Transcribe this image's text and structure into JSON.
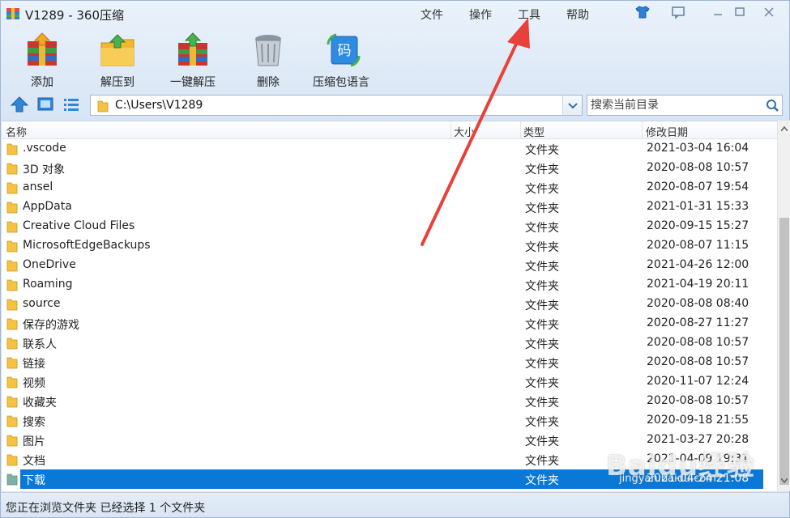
{
  "window": {
    "title": "V1289 - 360压缩",
    "menu": [
      "文件",
      "操作",
      "工具",
      "帮助"
    ]
  },
  "toolbar": {
    "add_label": "添加",
    "extract_to_label": "解压到",
    "one_click_extract_label": "一键解压",
    "delete_label": "删除",
    "language_label": "压缩包语言",
    "language_glyph": "码"
  },
  "address": {
    "path": "C:\\Users\\V1289"
  },
  "search": {
    "placeholder": "搜索当前目录"
  },
  "columns": {
    "name": "名称",
    "size": "大小",
    "type": "类型",
    "modified": "修改日期"
  },
  "files": [
    {
      "name": ".vscode",
      "type": "文件夹",
      "date": "2021-03-04 16:04"
    },
    {
      "name": "3D 对象",
      "type": "文件夹",
      "date": "2020-08-08 10:57"
    },
    {
      "name": "ansel",
      "type": "文件夹",
      "date": "2020-08-07 19:54"
    },
    {
      "name": "AppData",
      "type": "文件夹",
      "date": "2021-01-31 15:33"
    },
    {
      "name": "Creative Cloud Files",
      "type": "文件夹",
      "date": "2020-09-15 15:27"
    },
    {
      "name": "MicrosoftEdgeBackups",
      "type": "文件夹",
      "date": "2020-08-07 11:15"
    },
    {
      "name": "OneDrive",
      "type": "文件夹",
      "date": "2021-04-26 12:00"
    },
    {
      "name": "Roaming",
      "type": "文件夹",
      "date": "2021-04-19 20:11"
    },
    {
      "name": "source",
      "type": "文件夹",
      "date": "2020-08-08 08:40"
    },
    {
      "name": "保存的游戏",
      "type": "文件夹",
      "date": "2020-08-27 11:27"
    },
    {
      "name": "联系人",
      "type": "文件夹",
      "date": "2020-08-08 10:57"
    },
    {
      "name": "链接",
      "type": "文件夹",
      "date": "2020-08-08 10:57"
    },
    {
      "name": "视频",
      "type": "文件夹",
      "date": "2020-11-07 12:24"
    },
    {
      "name": "收藏夹",
      "type": "文件夹",
      "date": "2020-08-08 10:57"
    },
    {
      "name": "搜索",
      "type": "文件夹",
      "date": "2020-09-18 21:55"
    },
    {
      "name": "图片",
      "type": "文件夹",
      "date": "2021-03-27 20:28"
    },
    {
      "name": "文档",
      "type": "文件夹",
      "date": "2021-04-09 19:31"
    },
    {
      "name": "下载",
      "type": "文件夹",
      "date": "2021-04-24 21:08",
      "selected": true
    }
  ],
  "status": {
    "text": "您正在浏览文件夹 已经选择 1 个文件夹"
  },
  "watermark": {
    "text": "Baidu经验",
    "sub": "jingyan.baidu.com"
  },
  "colors": {
    "selection": "#0a78d7",
    "folder": "#f5c242",
    "annotation_arrow": "#e8413a"
  }
}
